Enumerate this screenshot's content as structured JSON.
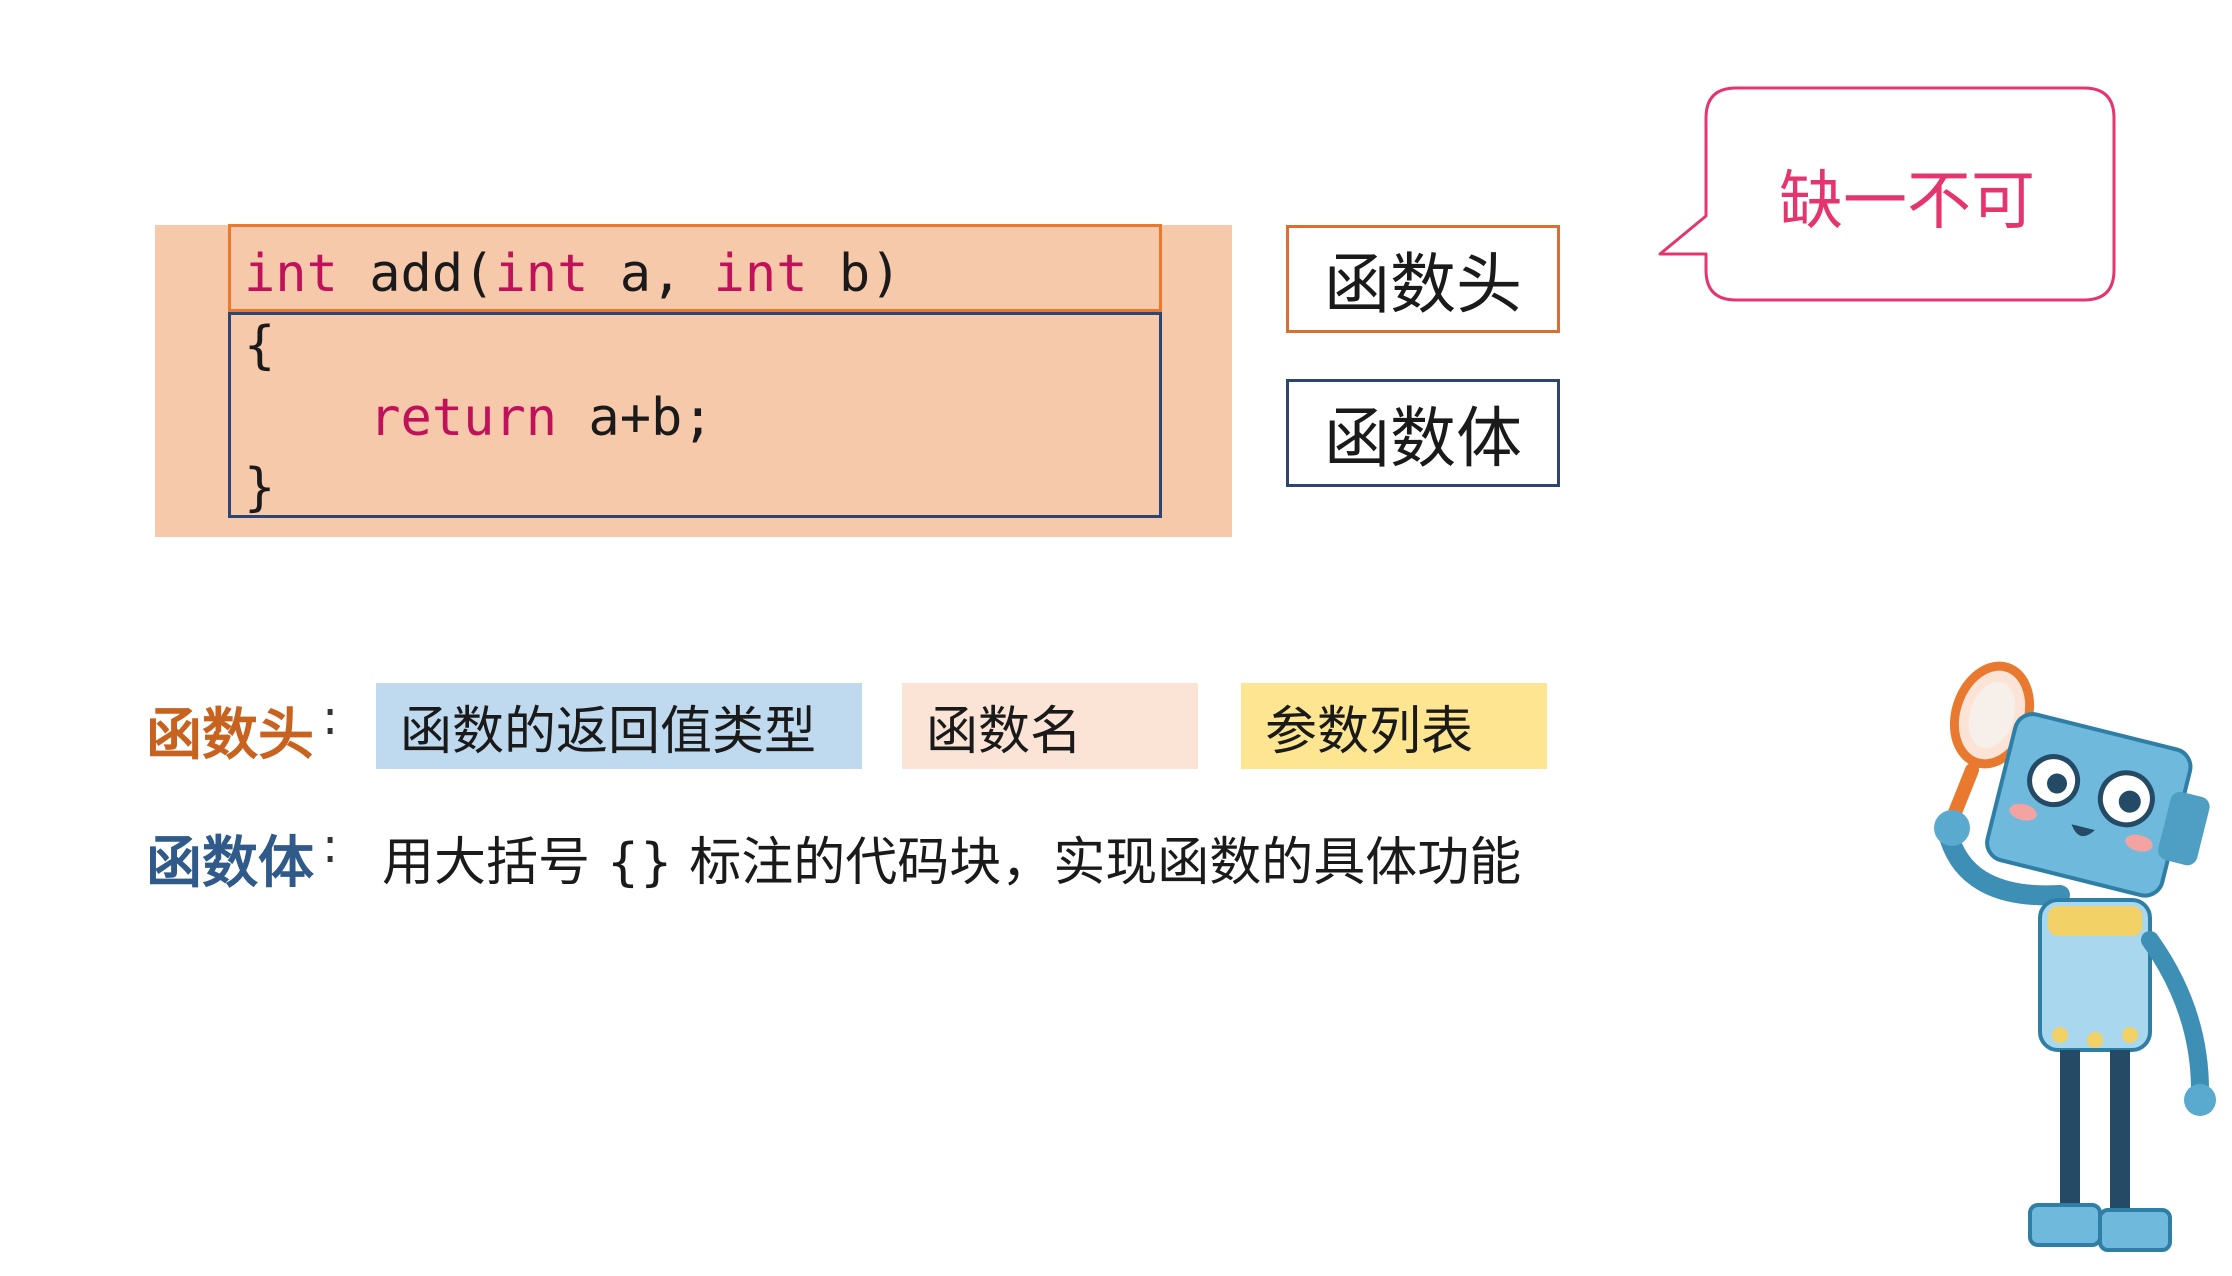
{
  "code": {
    "line1": {
      "kw1": "int",
      "t1": " add(",
      "kw2": "int",
      "t2": " a, ",
      "kw3": "int",
      "t3": " b)"
    },
    "line2": "{",
    "line3": {
      "indent": "    ",
      "kw": "return",
      "rest": " a+b;"
    },
    "line4": "}"
  },
  "labels": {
    "head": "函数头",
    "body": "函数体"
  },
  "bubble": {
    "text": "缺一不可"
  },
  "explain": {
    "head": {
      "title": "函数头",
      "colon": ":",
      "chips": [
        "函数的返回值类型",
        "函数名",
        "参数列表"
      ]
    },
    "body": {
      "title": "函数体",
      "colon": ":",
      "desc": "用大括号 {} 标注的代码块，实现函数的具体功能"
    }
  },
  "colors": {
    "keyword": "#c0125a",
    "head_title": "#c8621f",
    "body_title": "#2f5a8a",
    "chip_blue": "#bfd9ef",
    "chip_peach": "#fbe3d6",
    "chip_yellow": "#fde592",
    "bubble": "#e4356f",
    "code_bg": "#f7c9ab"
  },
  "illustration": {
    "icon": "robot-with-magnifying-glass-icon"
  }
}
